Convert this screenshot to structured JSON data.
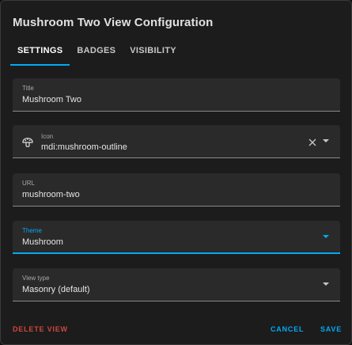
{
  "dialog": {
    "title": "Mushroom Two View Configuration"
  },
  "tabs": [
    {
      "label": "SETTINGS",
      "active": true
    },
    {
      "label": "BADGES",
      "active": false
    },
    {
      "label": "VISIBILITY",
      "active": false
    }
  ],
  "fields": {
    "title": {
      "label": "Title",
      "value": "Mushroom Two"
    },
    "icon": {
      "label": "Icon",
      "value": "mdi:mushroom-outline",
      "icon": "mushroom-outline-icon"
    },
    "url": {
      "label": "URL",
      "value": "mushroom-two"
    },
    "theme": {
      "label": "Theme",
      "value": "Mushroom"
    },
    "view_type": {
      "label": "View type",
      "value": "Masonry (default)"
    }
  },
  "actions": {
    "delete": "DELETE VIEW",
    "cancel": "CANCEL",
    "save": "SAVE"
  },
  "colors": {
    "accent": "#03a9f4",
    "danger": "#d0463e",
    "surface": "#1c1c1c",
    "field_bg": "#2a2a2a"
  }
}
